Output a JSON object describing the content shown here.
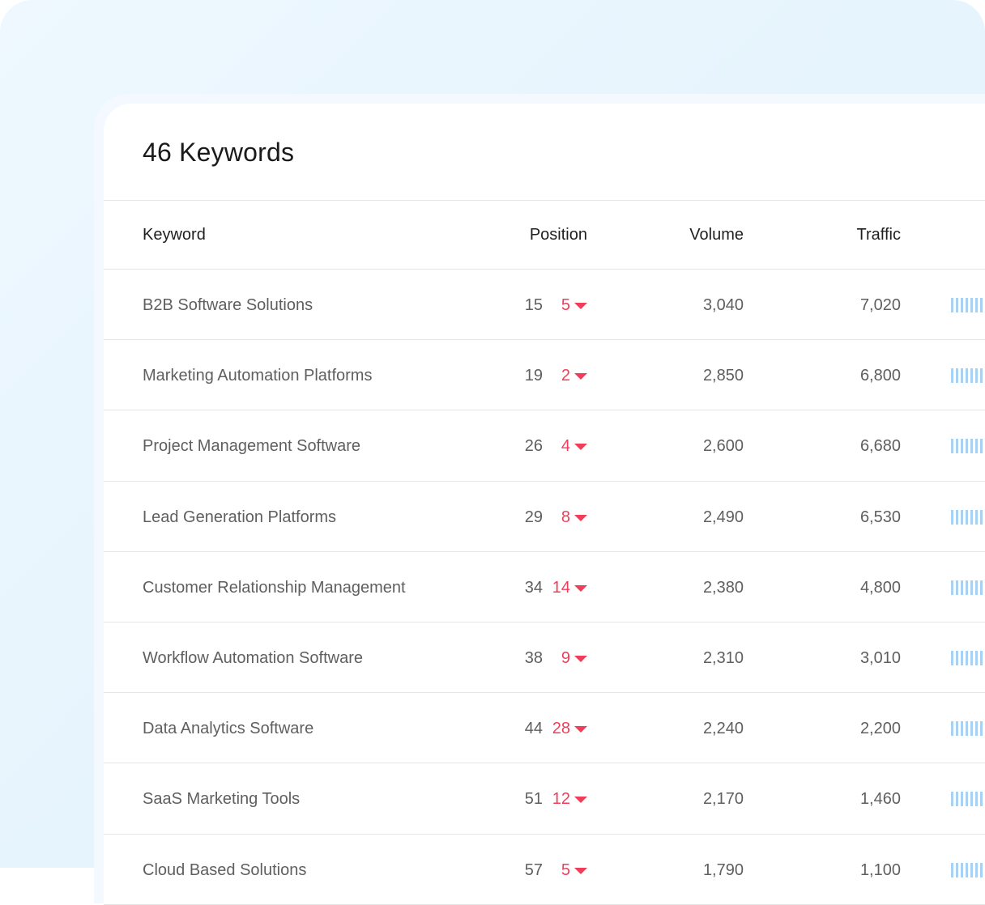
{
  "panel": {
    "title": "46 Keywords"
  },
  "table": {
    "headers": {
      "keyword": "Keyword",
      "position": "Position",
      "volume": "Volume",
      "traffic": "Traffic"
    },
    "rows": [
      {
        "keyword": "B2B Software Solutions",
        "position": "15",
        "change": "5",
        "volume": "3,040",
        "traffic": "7,020"
      },
      {
        "keyword": "Marketing Automation Platforms",
        "position": "19",
        "change": "2",
        "volume": "2,850",
        "traffic": "6,800"
      },
      {
        "keyword": "Project Management Software",
        "position": "26",
        "change": "4",
        "volume": "2,600",
        "traffic": "6,680"
      },
      {
        "keyword": "Lead Generation Platforms",
        "position": "29",
        "change": "8",
        "volume": "2,490",
        "traffic": "6,530"
      },
      {
        "keyword": "Customer Relationship Management",
        "position": "34",
        "change": "14",
        "volume": "2,380",
        "traffic": "4,800"
      },
      {
        "keyword": "Workflow Automation Software",
        "position": "38",
        "change": "9",
        "volume": "2,310",
        "traffic": "3,010"
      },
      {
        "keyword": "Data Analytics Software",
        "position": "44",
        "change": "28",
        "volume": "2,240",
        "traffic": "2,200"
      },
      {
        "keyword": "SaaS Marketing Tools",
        "position": "51",
        "change": "12",
        "volume": "2,170",
        "traffic": "1,460"
      },
      {
        "keyword": "Cloud Based Solutions",
        "position": "57",
        "change": "5",
        "volume": "1,790",
        "traffic": "1,100"
      }
    ]
  },
  "colors": {
    "decline": "#f03e5a",
    "trend_bar": "#a9d1f3",
    "background_gradient_start": "#eef8fe",
    "background_gradient_end": "#e2f2fc"
  },
  "icons": {
    "decline_indicator": "caret-down-icon",
    "trend": "trend-bars-icon"
  }
}
